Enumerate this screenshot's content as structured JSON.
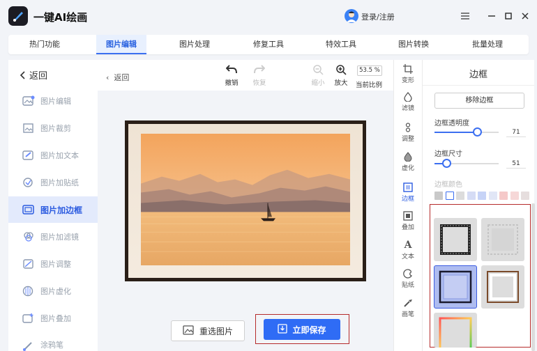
{
  "app": {
    "title": "一键AI绘画",
    "login": "登录/注册"
  },
  "tabs": [
    {
      "label": "热门功能"
    },
    {
      "label": "图片编辑",
      "active": true
    },
    {
      "label": "图片处理"
    },
    {
      "label": "修复工具"
    },
    {
      "label": "特效工具"
    },
    {
      "label": "图片转换"
    },
    {
      "label": "批量处理"
    }
  ],
  "sidebar": {
    "back": "返回",
    "items": [
      {
        "label": "图片编辑",
        "icon": "image-edit-icon"
      },
      {
        "label": "图片裁剪",
        "icon": "crop-icon"
      },
      {
        "label": "图片加文本",
        "icon": "add-text-icon"
      },
      {
        "label": "图片加贴纸",
        "icon": "sticker-icon"
      },
      {
        "label": "图片加边框",
        "icon": "frame-icon",
        "active": true
      },
      {
        "label": "图片加滤镜",
        "icon": "filter-icon"
      },
      {
        "label": "图片调整",
        "icon": "adjust-icon"
      },
      {
        "label": "图片虚化",
        "icon": "blur-icon"
      },
      {
        "label": "图片叠加",
        "icon": "overlay-icon"
      },
      {
        "label": "涂鸦笔",
        "icon": "brush-icon"
      }
    ]
  },
  "toolbar": {
    "back": "返回",
    "undo": "撤销",
    "redo": "恢复",
    "zoom_out": "缩小",
    "zoom_in": "放大",
    "zoom_value": "53.5 %",
    "zoom_label": "当前比例"
  },
  "actions": {
    "reselect": "重选图片",
    "save": "立即保存"
  },
  "tool_strip": [
    {
      "label": "变形",
      "icon": "transform-icon"
    },
    {
      "label": "滤镜",
      "icon": "filter-drop-icon"
    },
    {
      "label": "调整",
      "icon": "adjust-knob-icon"
    },
    {
      "label": "虚化",
      "icon": "blur-drop-icon"
    },
    {
      "label": "边框",
      "icon": "border-icon",
      "active": true
    },
    {
      "label": "叠加",
      "icon": "overlay-square-icon"
    },
    {
      "label": "文本",
      "icon": "text-icon"
    },
    {
      "label": "贴纸",
      "icon": "sticker-palette-icon"
    },
    {
      "label": "画笔",
      "icon": "paint-brush-icon"
    }
  ],
  "panel": {
    "title": "边框",
    "remove": "移除边框",
    "opacity_label": "边框透明度",
    "opacity_value": "71",
    "size_label": "边框尺寸",
    "size_value": "51",
    "color_label": "边框颜色",
    "colors": [
      "#c9c9c9",
      "#ffffff",
      "#dcdcdc",
      "#d5dcf5",
      "#c6d3f7",
      "#e1e6f6",
      "#f5c9c9",
      "#f6d8d8",
      "#e6dede"
    ]
  },
  "colors": {
    "accent": "#2f6cf5",
    "highlight": "#b52a2a"
  }
}
